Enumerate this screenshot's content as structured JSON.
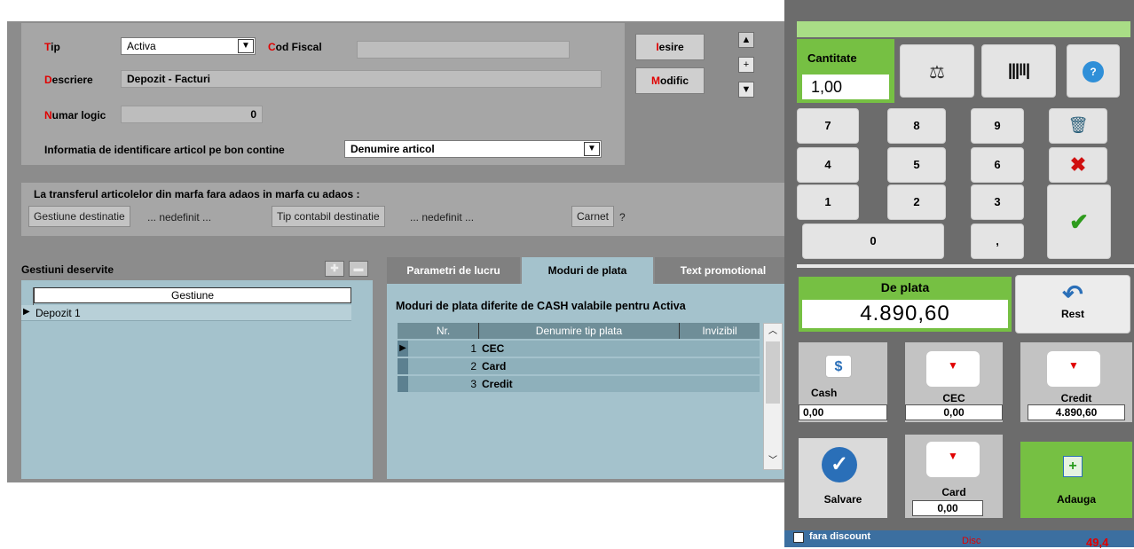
{
  "form": {
    "tip_label_first": "T",
    "tip_label_rest": "ip",
    "tip_value": "Activa",
    "cod_fiscal_label_first": "C",
    "cod_fiscal_label_rest": "od Fiscal",
    "cod_fiscal_value": "",
    "descriere_label_first": "D",
    "descriere_label_rest": "escriere",
    "descriere_value": "Depozit  - Facturi",
    "numar_logic_label_first": "N",
    "numar_logic_label_rest": "umar logic",
    "numar_logic_value": "0",
    "info_label": "Informatia de identificare articol pe bon contine",
    "info_value": "Denumire articol"
  },
  "buttons": {
    "iesire_first": "I",
    "iesire_rest": "esire",
    "modific_first": "M",
    "modific_rest": "odific",
    "plus": "+"
  },
  "transfer": {
    "title": "La transferul articolelor din marfa fara adaos in marfa cu adaos  :",
    "gestiune_btn": "Gestiune destinatie",
    "gestiune_value": "... nedefinit ...",
    "tip_btn": "Tip contabil destinatie",
    "tip_value": "... nedefinit ...",
    "carnet_btn": "Carnet",
    "carnet_value": "?"
  },
  "gestiuni": {
    "title": "Gestiuni deservite",
    "column": "Gestiune",
    "rows": [
      "Depozit 1"
    ]
  },
  "tabs": [
    "Parametri de lucru",
    "Moduri de plata",
    "Text promotional"
  ],
  "moduri": {
    "title": "Moduri de plata diferite de CASH valabile pentru Activa",
    "columns": [
      "Nr.",
      "Denumire tip plata",
      "Invizibil"
    ],
    "rows": [
      {
        "nr": "1",
        "name": "CEC"
      },
      {
        "nr": "2",
        "name": "Card"
      },
      {
        "nr": "3",
        "name": "Credit"
      }
    ]
  },
  "pos": {
    "cantitate_label": "Cantitate",
    "cantitate_value": "1,00",
    "keys": [
      "7",
      "8",
      "9",
      "4",
      "5",
      "6",
      "1",
      "2",
      "3",
      "0",
      ","
    ],
    "de_plata_label": "De plata",
    "de_plata_value": "4.890,60",
    "rest_label": "Rest",
    "cash_label": "Cash",
    "cash_value": "0,00",
    "cec_label": "CEC",
    "cec_value": "0,00",
    "credit_label": "Credit",
    "credit_value": "4.890,60",
    "salvare_label": "Salvare",
    "card_label": "Card",
    "card_value": "0,00",
    "adauga_label": "Adauga",
    "fara_discount_label": "fara discount",
    "disc_label": "Disc",
    "disc_value": "49,4"
  },
  "colors": {
    "accent_green": "#76c043",
    "gray_panel": "#8c8c8c",
    "blue_panel": "#a4c2cc",
    "red_label": "#e00000"
  }
}
